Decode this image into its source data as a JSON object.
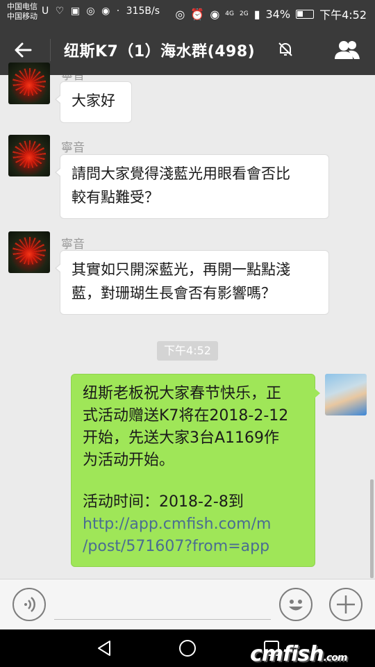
{
  "statusbar": {
    "carrier1": "中国电信",
    "carrier2": "中国移动",
    "net_speed": "315B/s",
    "signal_label1": "4G",
    "signal_label2": "2G",
    "battery": "34%",
    "time": "下午4:52"
  },
  "header": {
    "title": "纽斯K7（1）海水群(498)"
  },
  "messages": [
    {
      "sender": "",
      "text": "大家好"
    },
    {
      "sender": "寧音",
      "text_line1": "請問大家覺得淺藍光用眼看會否比",
      "text_line2": "較有點難受？"
    },
    {
      "sender": "寧音",
      "text_line1": "其實如只開深藍光，再開一點點淺",
      "text_line2": "藍，對珊瑚生長會否有影響嗎？"
    }
  ],
  "timestamp": "下午4:52",
  "outgoing": {
    "line1": "纽斯老板祝大家春节快乐，正",
    "line2": "式活动赠送K7将在2018-2-12",
    "line3": "开始，先送大家3台A1169作",
    "line4": "为活动开始。",
    "line5": "活动时间：2018-2-8到",
    "link1": "http://app.cmfish.com/m",
    "link2": "/post/571607?from=app"
  },
  "partial_sender_top": "寧音",
  "watermark": {
    "main": "cmfish",
    "suffix": ".com"
  }
}
